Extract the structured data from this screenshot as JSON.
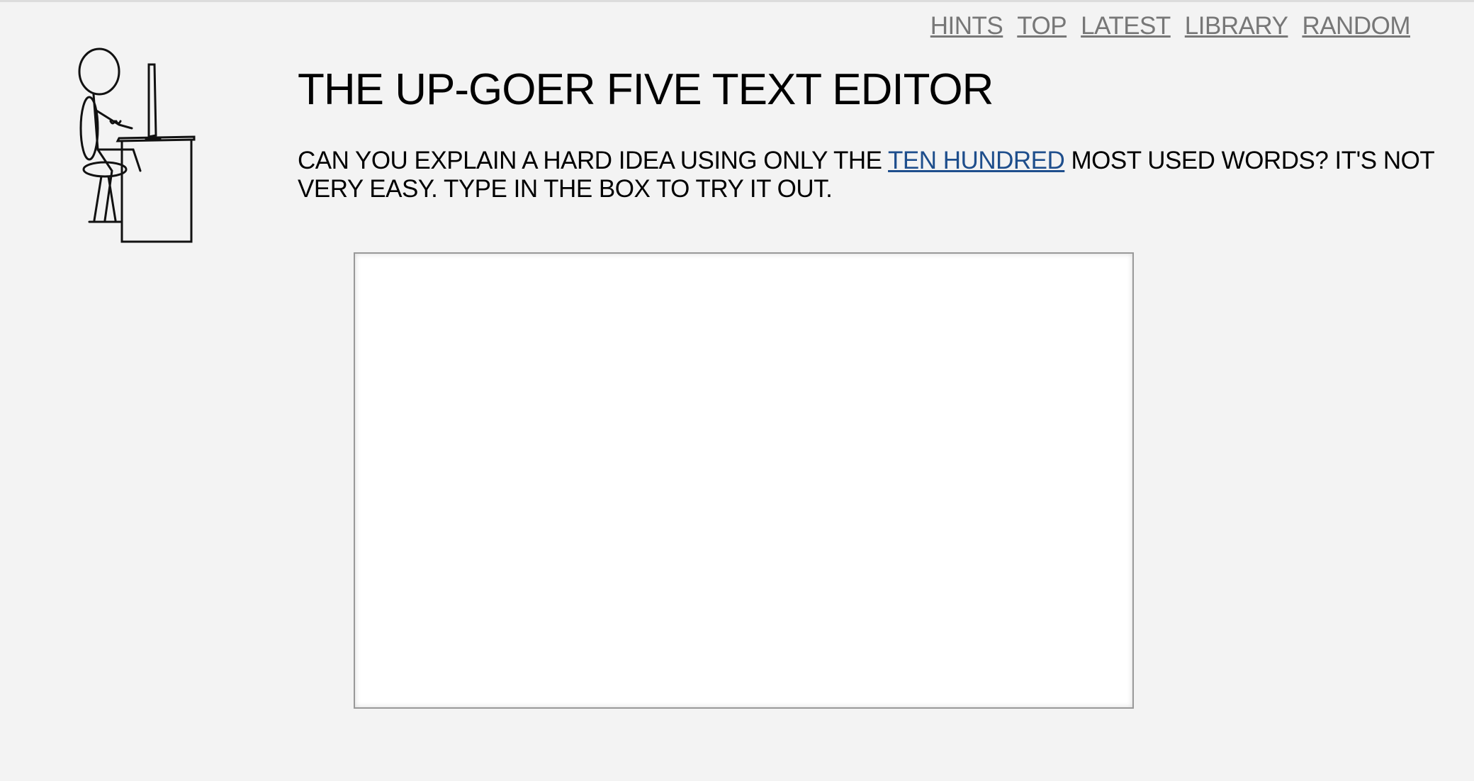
{
  "nav": {
    "items": [
      "Hints",
      "Top",
      "Latest",
      "Library",
      "Random"
    ]
  },
  "title": "The Up-Goer Five Text Editor",
  "intro": {
    "before": "Can you explain a hard idea using only the ",
    "link": "ten hundred",
    "after": " most used words? It's not very easy. Type in the box to try it out."
  },
  "editor": {
    "value": "",
    "placeholder": ""
  },
  "colors": {
    "background": "#f3f3f3",
    "link": "#1e4e8c",
    "nav": "#777777"
  }
}
